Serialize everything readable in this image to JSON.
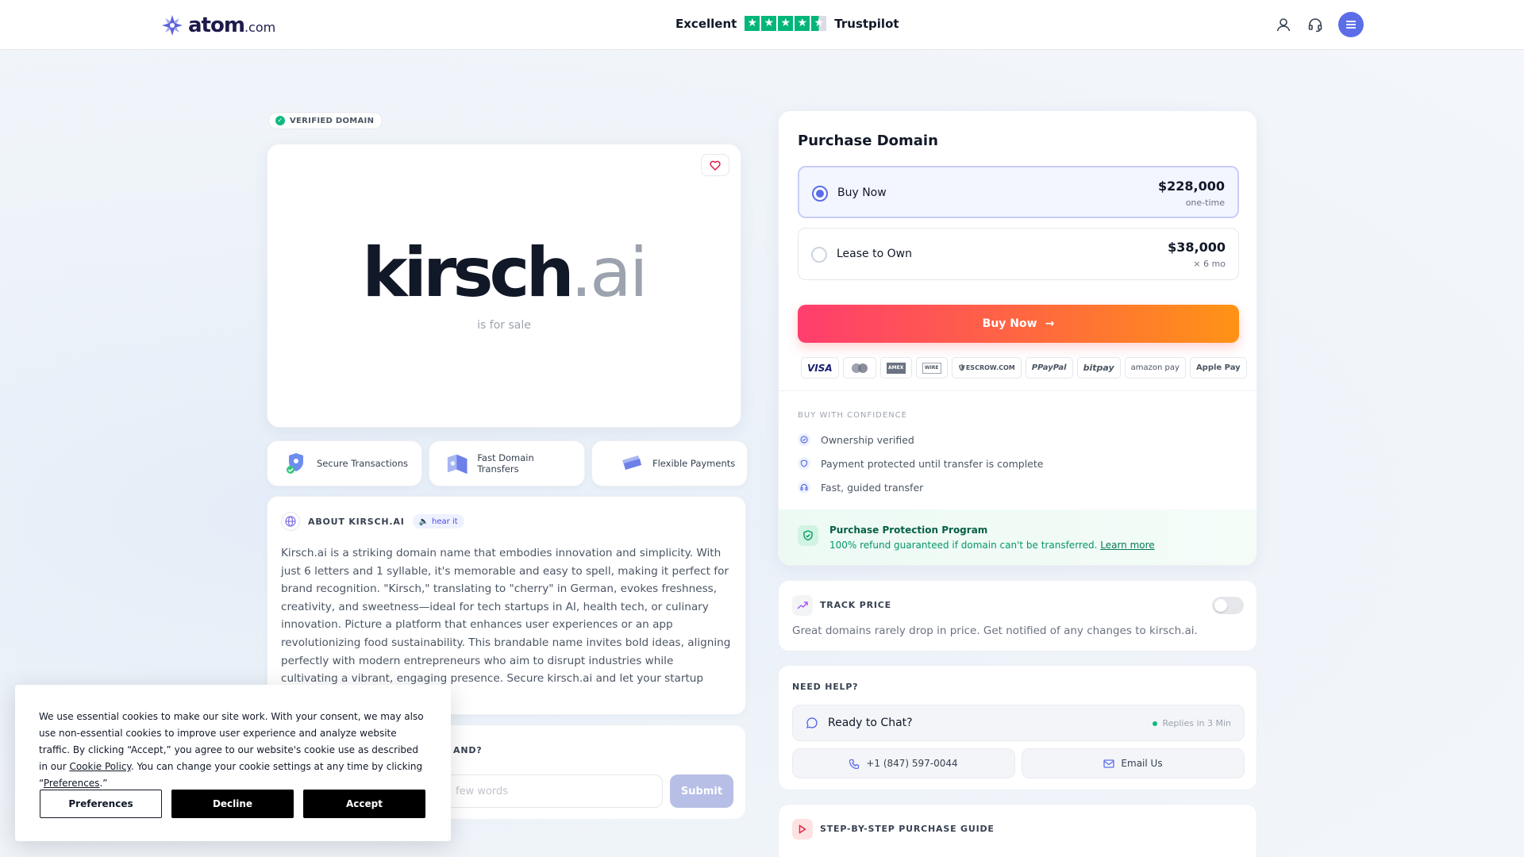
{
  "header": {
    "logo_main": "atom",
    "logo_suffix": ".com",
    "trust_label": "Excellent",
    "trust_brand": "Trustpilot",
    "trust_rating_stars": 4.5,
    "icons": [
      "user-icon",
      "headset-icon",
      "menu-icon"
    ]
  },
  "hero": {
    "badge": "VERIFIED DOMAIN",
    "domain_sld": "kirsch",
    "domain_tld": ".ai",
    "subtitle": "is for sale"
  },
  "features": [
    {
      "label": "Secure Transactions",
      "icon": "shield-icon"
    },
    {
      "label": "Fast Domain Transfers",
      "icon": "transfer-icon"
    },
    {
      "label": "Flexible Payments",
      "icon": "card-icon"
    }
  ],
  "about": {
    "title": "ABOUT KIRSCH.AI",
    "hear_it": "hear it",
    "text": "Kirsch.ai is a striking domain name that embodies innovation and simplicity. With just 6 letters and 1 syllable, it's memorable and easy to spell, making it perfect for brand recognition. \"Kirsch,\" translating to \"cherry\" in German, evokes freshness, creativity, and sweetness—ideal for tech startups in AI, health tech, or culinary innovation. Picture a platform that enhances user experiences or an app revolutionizing food sustainability. This brandable name invites bold ideas, aligning perfectly with modern entrepreneurs who aim to disrupt industries while cultivating a vibrant, engaging presence. Secure kirsch.ai and let your startup blossom!"
  },
  "brand": {
    "question_visible": "AND?",
    "placeholder": "few words",
    "submit": "Submit"
  },
  "purchase": {
    "title": "Purchase Domain",
    "options": [
      {
        "label": "Buy Now",
        "price": "$228,000",
        "sub": "one-time",
        "selected": true
      },
      {
        "label": "Lease to Own",
        "price": "$38,000",
        "sub": "× 6 mo",
        "selected": false
      }
    ],
    "buy_button": "Buy Now",
    "payment_methods": [
      "VISA",
      "MasterCard",
      "AMEX",
      "WIRE",
      "ESCROW.COM",
      "PayPal",
      "bitpay",
      "amazon pay",
      "Apple Pay"
    ],
    "confidence_title": "BUY WITH CONFIDENCE",
    "confidence_items": [
      "Ownership verified",
      "Payment protected until transfer is complete",
      "Fast, guided transfer"
    ],
    "protection_title": "Purchase Protection Program",
    "protection_text": "100% refund guaranteed if domain can't be transferred.",
    "protection_link": "Learn more"
  },
  "track": {
    "title": "TRACK PRICE",
    "text": "Great domains rarely drop in price. Get notified of any changes to kirsch.ai.",
    "toggle_on": false
  },
  "help": {
    "title": "NEED HELP?",
    "chat_label": "Ready to Chat?",
    "replies": "Replies in 3 Min",
    "phone": "+1 (847) 597-0044",
    "email": "Email Us"
  },
  "guide": {
    "title": "STEP-BY-STEP PURCHASE GUIDE"
  },
  "cookie": {
    "text_before": "We use essential cookies to make our site work. With your consent, we may also use non-essential cookies to improve user experience and analyze website traffic. By clicking “Accept,” you agree to our website's cookie use as described in our ",
    "policy_link": "Cookie Policy",
    "text_middle": ". You can change your cookie settings at any time by clicking “",
    "prefs_link": "Preferences",
    "text_after": ".”",
    "preferences": "Preferences",
    "decline": "Decline",
    "accept": "Accept"
  },
  "colors": {
    "accent": "#5b6ee8",
    "trustpilot_green": "#00b67a",
    "buy_gradient_start": "#ff3d6e",
    "buy_gradient_end": "#ff9315",
    "success": "#10b981"
  }
}
